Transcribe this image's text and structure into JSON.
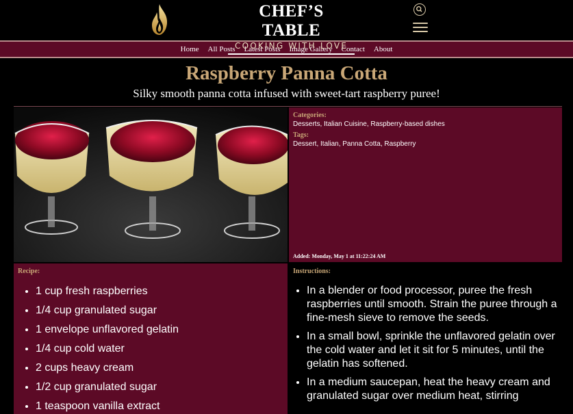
{
  "site": {
    "title": "CHEF’S TABLE",
    "tagline": "COOKING WITH LOVE",
    "logo_icon": "flame-icon",
    "search_icon": "search-icon",
    "menu_icon": "hamburger-menu-icon"
  },
  "nav": {
    "items": [
      {
        "label": "Home"
      },
      {
        "label": "All Posts"
      },
      {
        "label": "Latest Posts"
      },
      {
        "label": "Image Gallery"
      },
      {
        "label": "Contact"
      },
      {
        "label": "About"
      }
    ]
  },
  "post": {
    "title": "Raspberry Panna Cotta",
    "subtitle": "Silky smooth panna cotta infused with sweet-tart raspberry puree!",
    "categories_label": "Categories:",
    "categories": "Desserts, Italian Cuisine, Raspberry-based dishes",
    "tags_label": "Tags:",
    "tags": "Dessert, Italian, Panna Cotta, Raspberry",
    "added": "Added: Monday, May 1 at 11:22:24 AM",
    "recipe_label": "Recipe:",
    "recipe": [
      "1 cup fresh raspberries",
      "1/4 cup granulated sugar",
      "1 envelope unflavored gelatin",
      "1/4 cup cold water",
      "2 cups heavy cream",
      "1/2 cup granulated sugar",
      "1 teaspoon vanilla extract"
    ],
    "instructions_label": "Instructions:",
    "instructions": [
      "In a blender or food processor, puree the fresh raspberries until smooth. Strain the puree through a fine-mesh sieve to remove the seeds.",
      "In a small bowl, sprinkle the unflavored gelatin over the cold water and let it sit for 5 minutes, until the gelatin has softened.",
      "In a medium saucepan, heat the heavy cream and granulated sugar over medium heat, stirring"
    ]
  },
  "colors": {
    "background": "#000000",
    "accent_maroon": "#5c0a26",
    "gold": "#c9a777"
  }
}
